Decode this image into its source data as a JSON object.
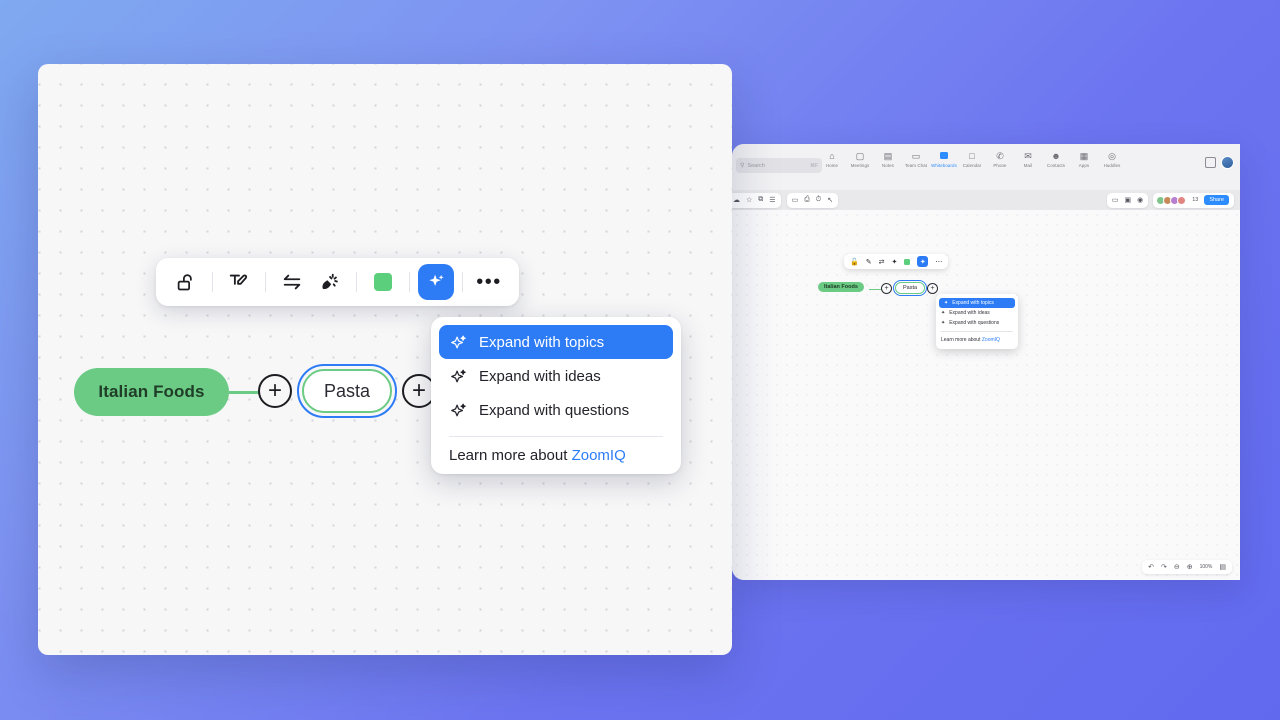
{
  "theme": {
    "bg_gradient_from": "#7FA9F0",
    "bg_gradient_to": "#6169EF",
    "accent_blue": "#2d7cf6",
    "node_green": "#6BCB84",
    "swatch_green": "#5BCF7C",
    "canvas_bg": "#f7f7f8"
  },
  "board": {
    "nodes": {
      "root_label": "Italian Foods",
      "child_label": "Pasta",
      "add_button_label": "+"
    }
  },
  "toolbar": {
    "items": [
      {
        "name": "unlock-icon",
        "title": "Unlock"
      },
      {
        "name": "edit-text-icon",
        "title": "Edit text"
      },
      {
        "name": "swap-icon",
        "title": "Swap"
      },
      {
        "name": "magic-wand-icon",
        "title": "Magic wand"
      },
      {
        "name": "color-swatch",
        "title": "Color"
      },
      {
        "name": "ai-sparkle-icon",
        "title": "ZoomIQ"
      },
      {
        "name": "more-icon",
        "title": "More options"
      }
    ],
    "more_label": "•••"
  },
  "menu": {
    "items": [
      {
        "label": "Expand with topics",
        "icon": "sparkle-icon",
        "selected": true
      },
      {
        "label": "Expand with ideas",
        "icon": "sparkle-icon",
        "selected": false
      },
      {
        "label": "Expand with questions",
        "icon": "sparkle-icon",
        "selected": false
      }
    ],
    "footer_text": "Learn more about ",
    "footer_link": "ZoomIQ"
  },
  "thumbnail": {
    "search": {
      "placeholder": "Search",
      "shortcut": "⌘F",
      "icon": "search-icon"
    },
    "nav_items": [
      {
        "label": "Home",
        "icon": "⌂",
        "active": false
      },
      {
        "label": "Meetings",
        "icon": "▢",
        "active": false
      },
      {
        "label": "Notes",
        "icon": "▤",
        "active": false
      },
      {
        "label": "Team Chat",
        "icon": "▭",
        "active": false
      },
      {
        "label": "Whiteboards",
        "icon": "",
        "active": true
      },
      {
        "label": "Calendar",
        "icon": "□",
        "active": false
      },
      {
        "label": "Phone",
        "icon": "✆",
        "active": false
      },
      {
        "label": "Mail",
        "icon": "✉",
        "active": false
      },
      {
        "label": "Contacts",
        "icon": "☻",
        "active": false
      },
      {
        "label": "Apps",
        "icon": "▦",
        "active": false
      },
      {
        "label": "Huddles",
        "icon": "◎",
        "active": false
      }
    ],
    "left_tools": [
      "☁",
      "☆",
      "⧉",
      "☰"
    ],
    "left_tools2": [
      "▭",
      "⎙",
      "⏱",
      "↖"
    ],
    "right_tools": [
      "▭",
      "▣",
      "◉"
    ],
    "participant_count": "13",
    "share_label": "Share",
    "bottom_bar": {
      "undo": "↶",
      "redo": "↷",
      "zoom_out": "⊖",
      "zoom_in": "⊕",
      "zoom_level": "100%",
      "lock": "▤"
    },
    "mini_menu": {
      "items": [
        "Expand with topics",
        "Expand with ideas",
        "Expand with questions"
      ],
      "footer_text": "Learn more about ",
      "footer_link": "ZoomIQ"
    },
    "mini_nodes": {
      "root": "Italian Foods",
      "child": "Pasta",
      "plus": "+"
    }
  }
}
